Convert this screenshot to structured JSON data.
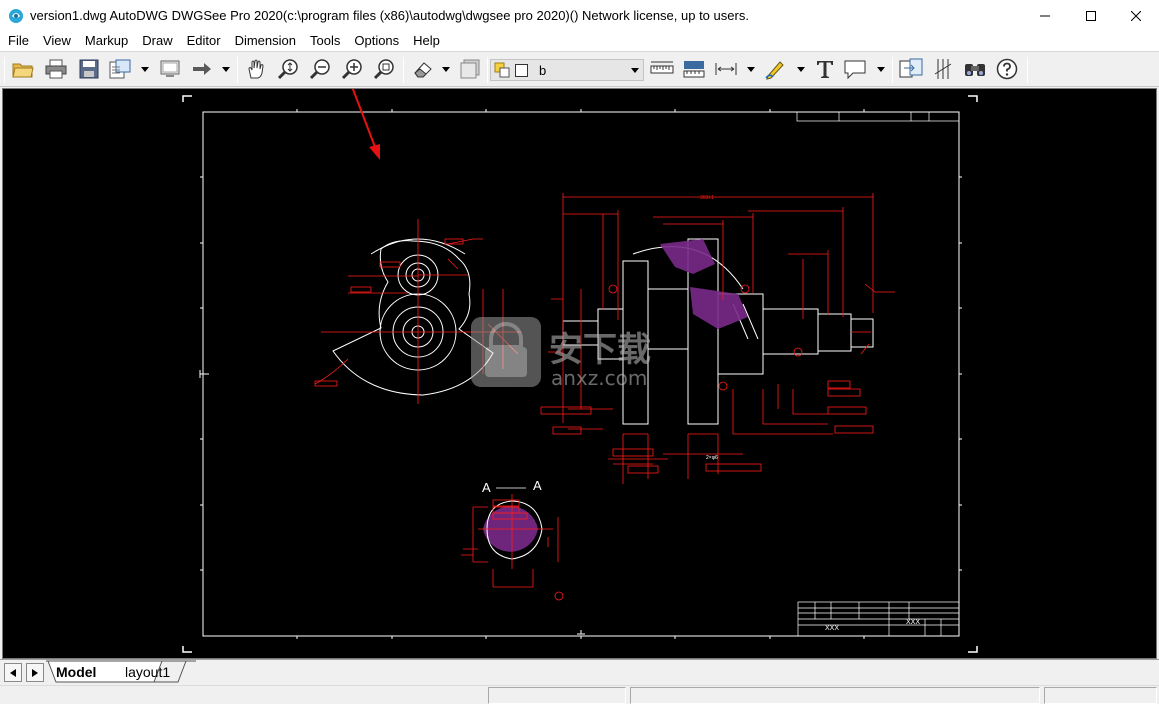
{
  "window": {
    "title": "version1.dwg AutoDWG DWGSee Pro 2020(c:\\program files (x86)\\autodwg\\dwgsee pro 2020)() Network license, up to  users."
  },
  "menu": [
    "File",
    "View",
    "Markup",
    "Draw",
    "Editor",
    "Dimension",
    "Tools",
    "Options",
    "Help"
  ],
  "toolbar": {
    "buttons": [
      "open-icon",
      "print-icon",
      "save-icon",
      "export-icon",
      "screen-icon",
      "arrow-right-icon",
      "pan-hand-icon",
      "zoom-realtime-icon",
      "zoom-out-icon",
      "zoom-in-icon",
      "zoom-extents-icon",
      "eraser-icon",
      "layer-icon",
      "measure-length-icon",
      "measure-area-icon",
      "dimension-icon",
      "pen-icon",
      "text-icon",
      "comment-icon",
      "compare-icon",
      "hatch-icon",
      "find-icon",
      "help-icon"
    ],
    "layer_value": "b"
  },
  "drawing": {
    "section_label_left": "A",
    "section_label_right": "A",
    "title_block_text": "XXX",
    "watermark_text": "安下载",
    "watermark_url": "anxz.com",
    "dim_top": "303±1",
    "dim_b": "2×φ6"
  },
  "tabs": {
    "model": "Model",
    "layout1": "layout1"
  },
  "colors": {
    "canvas": "#000000",
    "red": "#ff1a1a",
    "white": "#ffffff",
    "hatch": "#a040c0"
  }
}
